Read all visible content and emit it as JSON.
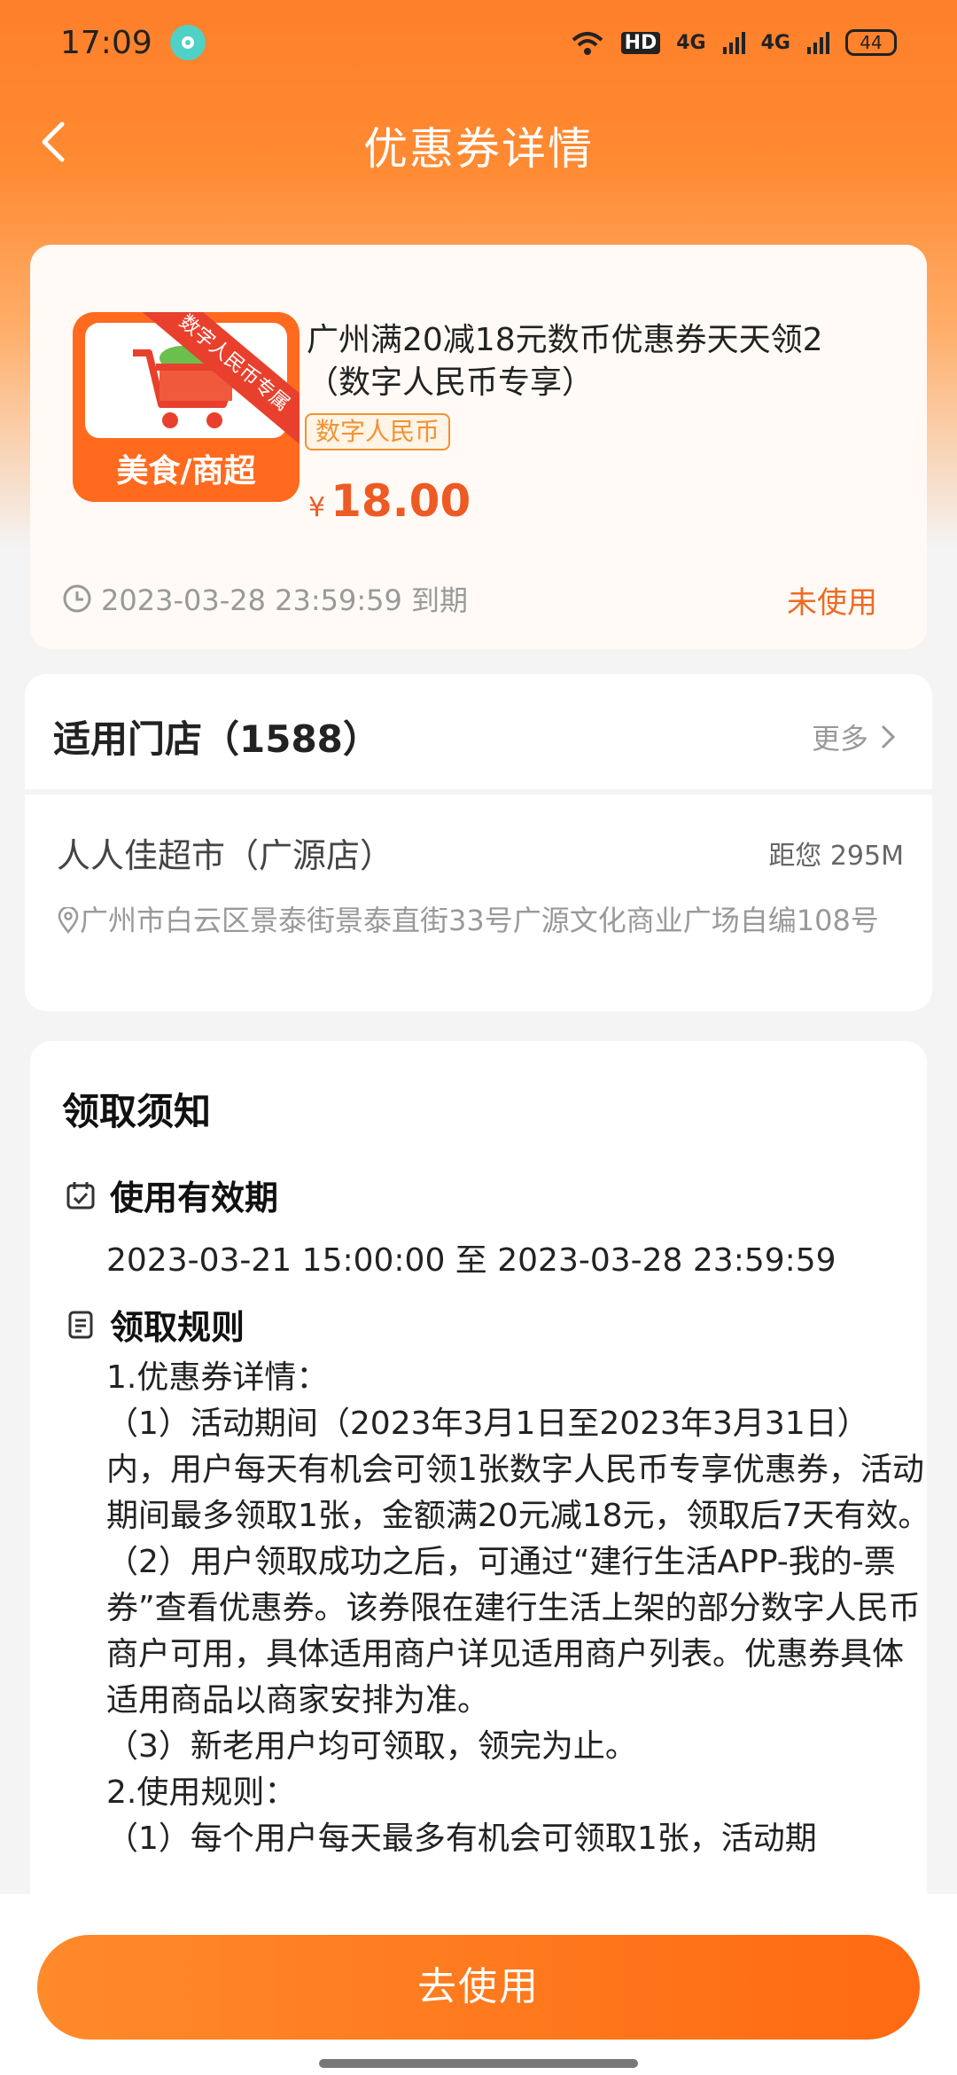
{
  "status_bar": {
    "time": "17:09",
    "network_1": "4G",
    "network_2": "4G",
    "hd_label": "HD",
    "battery": "44"
  },
  "header": {
    "title": "优惠券详情"
  },
  "coupon": {
    "thumb_ribbon": "数字人民币专属",
    "thumb_label": "美食/商超",
    "title": "广州满20减18元数币优惠券天天领2（数字人民币专享）",
    "tag": "数字人民币",
    "price_symbol": "¥",
    "price": "18.00",
    "expire": "2023-03-28 23:59:59 到期",
    "status": "未使用",
    "accent_color": "#ee5a24"
  },
  "stores": {
    "title": "适用门店（1588）",
    "more": "更多",
    "store_name": "人人佳超市（广源店）",
    "distance": "距您 295M",
    "address": "广州市白云区景泰街景泰直街33号广源文化商业广场自编108号"
  },
  "notice": {
    "title": "领取须知",
    "validity_heading": "使用有效期",
    "validity_range": "2023-03-21 15:00:00 至 2023-03-28 23:59:59",
    "rules_heading": "领取规则",
    "rules_text": "1.优惠券详情：\n（1）活动期间（2023年3月1日至2023年3月31日）内，用户每天有机会可领1张数字人民币专享优惠券，活动期间最多领取1张，金额满20元减18元，领取后7天有效。\n（2）用户领取成功之后，可通过“建行生活APP-我的-票券”查看优惠券。该券限在建行生活上架的部分数字人民币商户可用，具体适用商户详见适用商户列表。优惠券具体适用商品以商家安排为准。\n（3）新老用户均可领取，领完为止。\n2.使用规则：\n（1）每个用户每天最多有机会可领取1张，活动期"
  },
  "bottom": {
    "use_button": "去使用"
  }
}
